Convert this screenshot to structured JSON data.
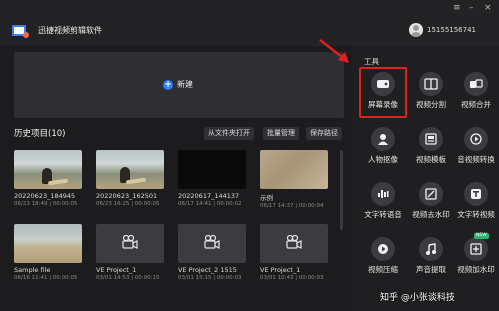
{
  "app": {
    "title": "迅捷视频剪辑软件",
    "user_phone": "15155156741"
  },
  "window_controls": {
    "menu": "≡",
    "minimize": "–",
    "close": "×"
  },
  "new_project": {
    "label": "新建"
  },
  "history": {
    "title": "历史项目(10)",
    "open_from_file": "从文件夹打开",
    "batch_manage": "批量管理",
    "save_path": "保存路径",
    "projects": [
      {
        "name": "20220623_184945",
        "meta": "06/23 18:49 | 00:00:05",
        "thumb": "beach"
      },
      {
        "name": "20220623_162501",
        "meta": "06/23 16:25 | 00:00:05",
        "thumb": "beach"
      },
      {
        "name": "20220617_144137",
        "meta": "06/17 14:41 | 00:00:02",
        "thumb": "dark"
      },
      {
        "name": "示例",
        "meta": "06/17 14:37 | 00:00:04",
        "thumb": "sand"
      },
      {
        "name": "Sample file",
        "meta": "06/16 11:41 | 00:00:05",
        "thumb": "sample"
      },
      {
        "name": "VE Project_1",
        "meta": "03/01 14:53 | 00:00:15",
        "thumb": "project"
      },
      {
        "name": "VE Project_2 1515",
        "meta": "03/01 15:15 | 00:00:03",
        "thumb": "project"
      },
      {
        "name": "VE Project_1",
        "meta": "03/01 10:43 | 00:00:03",
        "thumb": "project"
      }
    ]
  },
  "tools": {
    "title": "工具",
    "items": [
      {
        "label": "屏幕录像",
        "icon": "screen-record-icon"
      },
      {
        "label": "视频分割",
        "icon": "video-split-icon"
      },
      {
        "label": "视频合并",
        "icon": "video-merge-icon"
      },
      {
        "label": "人物抠像",
        "icon": "portrait-cutout-icon"
      },
      {
        "label": "视频模板",
        "icon": "video-template-icon"
      },
      {
        "label": "音视频转换",
        "icon": "av-convert-icon"
      },
      {
        "label": "文字转语音",
        "icon": "text-to-speech-icon"
      },
      {
        "label": "视频去水印",
        "icon": "remove-watermark-icon"
      },
      {
        "label": "文字转视频",
        "icon": "text-to-video-icon"
      },
      {
        "label": "视频压缩",
        "icon": "video-compress-icon"
      },
      {
        "label": "声音提取",
        "icon": "audio-extract-icon"
      },
      {
        "label": "视频加水印",
        "icon": "add-watermark-icon"
      }
    ],
    "new_badge": "NEW"
  },
  "watermark": "知乎 @小张谈科技"
}
